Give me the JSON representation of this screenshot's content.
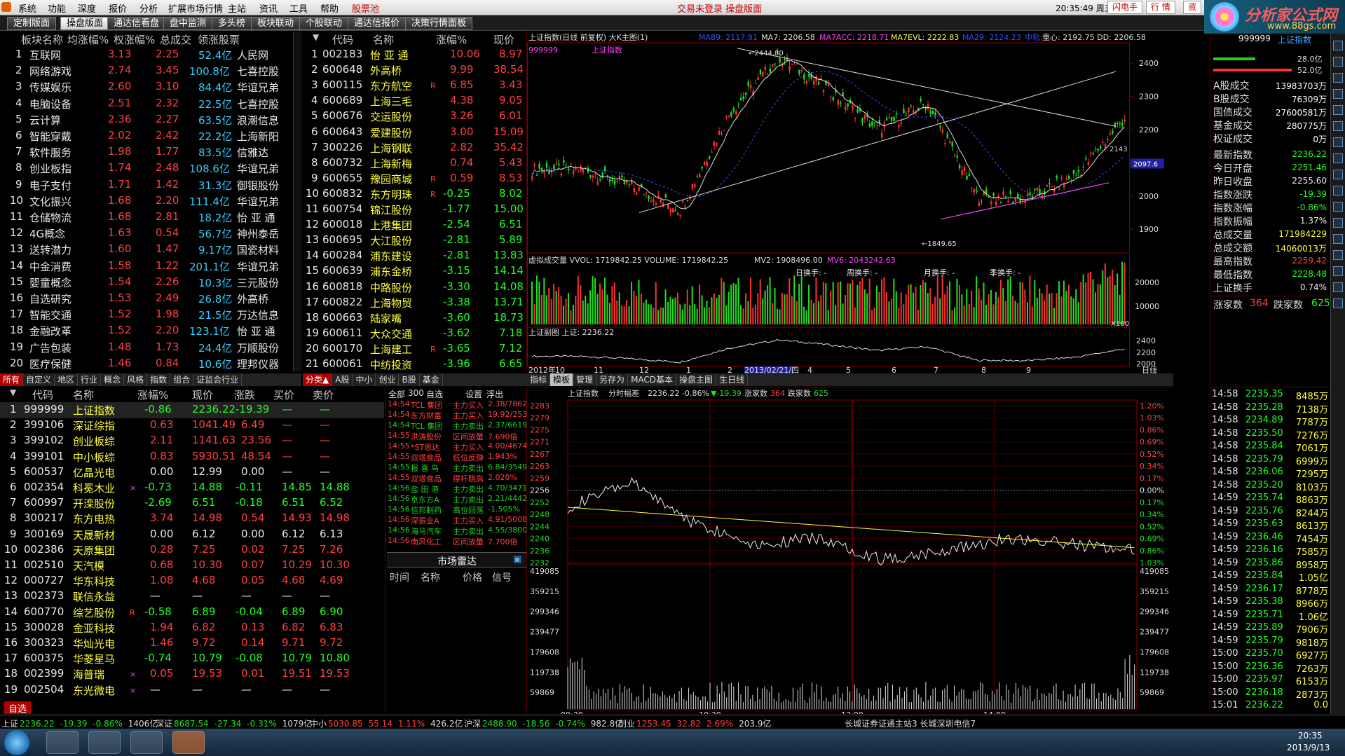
{
  "menu": {
    "items": [
      "系统",
      "功能",
      "深度",
      "报价",
      "分析",
      "扩展市场行情",
      "主站",
      "资讯",
      "工具",
      "帮助",
      "股票池"
    ],
    "center_title": "交易未登录   操盘版面",
    "clock": "20:35:49 周五",
    "right_buttons": [
      "闪电手",
      "行 情",
      "资"
    ]
  },
  "logo": {
    "text": "分析家公式网",
    "url": "www.88gs.com"
  },
  "tabs": [
    "定制版面",
    "操盘版面",
    "通达信看盘",
    "盘中监测",
    "多头榜",
    "板块联动",
    "个股联动",
    "通达信报价",
    "决策行情面板"
  ],
  "sector_table": {
    "headers": [
      "板块名称",
      "均涨幅%",
      "权涨幅%",
      "总成交",
      "领涨股票"
    ],
    "rows": [
      [
        "1",
        "互联网",
        "3.13",
        "2.25",
        "52.4亿",
        "人民网"
      ],
      [
        "2",
        "网络游戏",
        "2.74",
        "3.45",
        "100.8亿",
        "七喜控股"
      ],
      [
        "3",
        "传媒娱乐",
        "2.60",
        "3.10",
        "84.4亿",
        "华谊兄弟"
      ],
      [
        "4",
        "电脑设备",
        "2.51",
        "2.32",
        "22.5亿",
        "七喜控股"
      ],
      [
        "5",
        "云计算",
        "2.36",
        "2.27",
        "63.5亿",
        "浪潮信息"
      ],
      [
        "6",
        "智能穿戴",
        "2.02",
        "2.42",
        "22.2亿",
        "上海新阳"
      ],
      [
        "7",
        "软件服务",
        "1.98",
        "1.77",
        "83.5亿",
        "信雅达"
      ],
      [
        "8",
        "创业板指",
        "1.74",
        "2.48",
        "108.6亿",
        "华谊兄弟"
      ],
      [
        "9",
        "电子支付",
        "1.71",
        "1.42",
        "31.3亿",
        "御银股份"
      ],
      [
        "10",
        "文化振兴",
        "1.68",
        "2.20",
        "111.4亿",
        "华谊兄弟"
      ],
      [
        "11",
        "仓储物流",
        "1.68",
        "2.81",
        "18.2亿",
        "怡 亚 通"
      ],
      [
        "12",
        "4G概念",
        "1.63",
        "0.54",
        "56.7亿",
        "神州泰岳"
      ],
      [
        "13",
        "送转潜力",
        "1.60",
        "1.47",
        "9.17亿",
        "国瓷材料"
      ],
      [
        "14",
        "中金消费",
        "1.58",
        "1.22",
        "201.1亿",
        "华谊兄弟"
      ],
      [
        "15",
        "婴童概念",
        "1.54",
        "2.26",
        "10.3亿",
        "三元股份"
      ],
      [
        "16",
        "自选研究",
        "1.53",
        "2.49",
        "26.8亿",
        "外高桥"
      ],
      [
        "17",
        "智能交通",
        "1.52",
        "1.98",
        "21.5亿",
        "万达信息"
      ],
      [
        "18",
        "金融改革",
        "1.52",
        "2.20",
        "123.1亿",
        "怡 亚 通"
      ],
      [
        "19",
        "广告包装",
        "1.48",
        "1.73",
        "24.4亿",
        "万顺股份"
      ],
      [
        "20",
        "医疗保健",
        "1.46",
        "0.84",
        "10.6亿",
        "理邦仪器"
      ]
    ]
  },
  "stock_rank": {
    "headers": [
      "代码",
      "名称",
      "涨幅%",
      "现价"
    ],
    "rows": [
      [
        "1",
        "002183",
        "怡 亚 通",
        "",
        "10.06",
        "8.97"
      ],
      [
        "2",
        "600648",
        "外高桥",
        "",
        "9.99",
        "38.54"
      ],
      [
        "3",
        "600115",
        "东方航空",
        "R",
        "6.85",
        "3.43"
      ],
      [
        "4",
        "600689",
        "上海三毛",
        "",
        "4.38",
        "9.05"
      ],
      [
        "5",
        "600676",
        "交运股份",
        "",
        "3.26",
        "6.01"
      ],
      [
        "6",
        "600643",
        "爱建股份",
        "",
        "3.00",
        "15.09"
      ],
      [
        "7",
        "300226",
        "上海钢联",
        "",
        "2.82",
        "35.42"
      ],
      [
        "8",
        "600732",
        "上海新梅",
        "",
        "0.74",
        "5.43"
      ],
      [
        "9",
        "600655",
        "豫园商城",
        "R",
        "0.59",
        "8.53"
      ],
      [
        "10",
        "600832",
        "东方明珠",
        "R",
        "-0.25",
        "8.02"
      ],
      [
        "11",
        "600754",
        "锦江股份",
        "",
        "-1.77",
        "15.00"
      ],
      [
        "12",
        "600018",
        "上港集团",
        "",
        "-2.54",
        "6.51"
      ],
      [
        "13",
        "600695",
        "大江股份",
        "",
        "-2.81",
        "5.89"
      ],
      [
        "14",
        "600284",
        "浦东建设",
        "",
        "-2.81",
        "13.83"
      ],
      [
        "15",
        "600639",
        "浦东金桥",
        "",
        "-3.15",
        "14.14"
      ],
      [
        "16",
        "600818",
        "中路股份",
        "",
        "-3.30",
        "14.08"
      ],
      [
        "17",
        "600822",
        "上海物贸",
        "",
        "-3.38",
        "13.71"
      ],
      [
        "18",
        "600663",
        "陆家嘴",
        "",
        "-3.60",
        "18.73"
      ],
      [
        "19",
        "600611",
        "大众交通",
        "",
        "-3.62",
        "7.18"
      ],
      [
        "20",
        "600170",
        "上海建工",
        "R",
        "-3.65",
        "7.12"
      ],
      [
        "21",
        "600061",
        "中纺投资",
        "",
        "-3.96",
        "6.65"
      ]
    ]
  },
  "market_tabs": [
    "所有",
    "自定义",
    "地区",
    "行业",
    "概念",
    "风格",
    "指数",
    "组合",
    "证监会行业"
  ],
  "rank_tabs": [
    "分类▲",
    "A股",
    "中小",
    "创业",
    "B股",
    "基金"
  ],
  "quote_table": {
    "headers": [
      "代码",
      "名称",
      "涨幅%",
      "现价",
      "涨跌",
      "买价",
      "卖价"
    ],
    "rows": [
      [
        "1",
        "999999",
        "上证指数",
        "",
        "-0.86",
        "2236.22",
        "-19.39",
        "—",
        "—"
      ],
      [
        "2",
        "399106",
        "深证综指",
        "",
        "0.63",
        "1041.49",
        "6.49",
        "—",
        "—"
      ],
      [
        "3",
        "399102",
        "创业板综",
        "",
        "2.11",
        "1141.63",
        "23.56",
        "—",
        "—"
      ],
      [
        "4",
        "399101",
        "中小板综",
        "",
        "0.83",
        "5930.51",
        "48.54",
        "—",
        "—"
      ],
      [
        "5",
        "600537",
        "亿晶光电",
        "",
        "0.00",
        "12.99",
        "0.00",
        "—",
        "—"
      ],
      [
        "6",
        "002354",
        "科冕木业",
        "×",
        "-0.73",
        "14.88",
        "-0.11",
        "14.85",
        "14.88"
      ],
      [
        "7",
        "600997",
        "开滦股份",
        "",
        "-2.69",
        "6.51",
        "-0.18",
        "6.51",
        "6.52"
      ],
      [
        "8",
        "300217",
        "东方电热",
        "",
        "3.74",
        "14.98",
        "0.54",
        "14.93",
        "14.98"
      ],
      [
        "9",
        "300169",
        "天晟新材",
        "",
        "0.00",
        "6.12",
        "0.00",
        "6.12",
        "6.13"
      ],
      [
        "10",
        "002386",
        "天原集团",
        "",
        "0.28",
        "7.25",
        "0.02",
        "7.25",
        "7.26"
      ],
      [
        "11",
        "002510",
        "天汽模",
        "",
        "0.68",
        "10.30",
        "0.07",
        "10.29",
        "10.30"
      ],
      [
        "12",
        "000727",
        "华东科技",
        "",
        "1.08",
        "4.68",
        "0.05",
        "4.68",
        "4.69"
      ],
      [
        "13",
        "002373",
        "联信永益",
        "",
        "—",
        "—",
        "—",
        "—",
        "—"
      ],
      [
        "14",
        "600770",
        "综艺股份",
        "R",
        "-0.58",
        "6.89",
        "-0.04",
        "6.89",
        "6.90"
      ],
      [
        "15",
        "300028",
        "金亚科技",
        "",
        "1.94",
        "6.82",
        "0.13",
        "6.82",
        "6.83"
      ],
      [
        "16",
        "300323",
        "华灿光电",
        "",
        "1.46",
        "9.72",
        "0.14",
        "9.71",
        "9.72"
      ],
      [
        "17",
        "600375",
        "华菱星马",
        "",
        "-0.74",
        "10.79",
        "-0.08",
        "10.79",
        "10.80"
      ],
      [
        "18",
        "002399",
        "海普瑞",
        "×",
        "0.05",
        "19.53",
        "0.01",
        "19.51",
        "19.53"
      ],
      [
        "19",
        "002504",
        "东光微电",
        "×",
        "—",
        "—",
        "—",
        "—",
        "—"
      ]
    ],
    "footer_tab": "自选"
  },
  "monitor": {
    "tabs": [
      "全部",
      "300",
      "自选",
      "设置",
      "浮出"
    ],
    "items": [
      [
        "14:54",
        "TCL 集团",
        "主力买入",
        "2.38/7862"
      ],
      [
        "14:54",
        "东方财富",
        "主力买入",
        "19.92/2539"
      ],
      [
        "14:54",
        "TCL 集团",
        "主力卖出",
        "2.37/6619"
      ],
      [
        "14:55",
        "洪涛股份",
        "区间放量",
        "7.690倍"
      ],
      [
        "14:55",
        "*ST思达",
        "主力买入",
        "4.00/4674"
      ],
      [
        "14:55",
        "双塔食品",
        "低位反弹",
        "1.943%"
      ],
      [
        "14:55",
        "报 喜 鸟",
        "主力卖出",
        "6.84/3549"
      ],
      [
        "14:55",
        "双塔食品",
        "撑杆跳高",
        "2.020%"
      ],
      [
        "14:56",
        "盐 田 港",
        "主力卖出",
        "4.70/3471"
      ],
      [
        "14:56",
        "京东方A",
        "主力卖出",
        "2.21/4442"
      ],
      [
        "14:56",
        "信邦制药",
        "高位回落",
        "-1.505%"
      ],
      [
        "14:56",
        "深振业A",
        "主力买入",
        "4.91/5008"
      ],
      [
        "14:56",
        "海马汽车",
        "主力卖出",
        "4.55/3800"
      ],
      [
        "14:56",
        "南风化工",
        "区间放量",
        "7.700倍"
      ]
    ],
    "radar_title": "市场雷达",
    "radar_headers": [
      "时间",
      "名称",
      "价格",
      "信号"
    ]
  },
  "kline": {
    "title": "上证指数(日线 前复权) 大K主图(1)",
    "ma_labels": [
      {
        "text": "MA89: 2117.81",
        "color": "#3050ff"
      },
      {
        "text": "MA7: 2206.58",
        "color": "#e0e0e0"
      },
      {
        "text": "MA7ACC: 2218.71",
        "color": "#ff40ff"
      },
      {
        "text": "MA7EVL: 2222.83",
        "color": "#ffff40"
      },
      {
        "text": "MA29: 2124.23",
        "color": "#3050ff"
      },
      {
        "text": "中轨: ...",
        "color": "#3050ff"
      }
    ],
    "right_info": "重心: 2192.75  DD: 2206.58",
    "subtitle_code": "999999",
    "subtitle_name": "上证指数",
    "yticks": [
      "2400",
      "2300",
      "2200",
      "2100",
      "2000",
      "1900"
    ],
    "high_label": "2444.80",
    "low_label": "1849.65",
    "cur_label": "2097.6",
    "cur_small": "2143"
  },
  "volume": {
    "title": "虚拟成交量  VVOL: 1719842.25  VOLUME: 1719842.25",
    "mv2": "MV2: 1908496.00",
    "mv6": "MV6: 2043242.63",
    "turnover": [
      "日换手: -",
      "周换手: -",
      "月换手: -",
      "季换手: -"
    ],
    "yticks": [
      "20000",
      "10000"
    ],
    "unit": "X100"
  },
  "sub_chart": {
    "title": "上证副图  上证: 2236.22",
    "yticks": [
      "2400",
      "2200",
      "2000"
    ]
  },
  "date_axis": {
    "labels": [
      "2012年",
      "10",
      "11",
      "12",
      "1",
      "2",
      "2013/02/21/四",
      "4",
      "5",
      "6",
      "7",
      "8",
      "9"
    ],
    "unit": "日线"
  },
  "indicator_tabs": [
    "指标",
    "模板",
    "管理",
    "另存为",
    "MACD基本",
    "操盘主图",
    "生日线"
  ],
  "intraday": {
    "title": "上证指数",
    "subtitle": "分时幅差",
    "value": "2236.22 -0.86%",
    "change": "▼-19.39",
    "up_label": "涨家数",
    "up_count": "364",
    "down_label": "跌家数",
    "down_count": "625",
    "left_ticks": [
      "2283",
      "2279",
      "2275",
      "2271",
      "2267",
      "2263",
      "2259",
      "2256",
      "2252",
      "2248",
      "2244",
      "2240",
      "2236",
      "2232"
    ],
    "right_ticks": [
      "1.20%",
      "1.03%",
      "0.86%",
      "0.69%",
      "0.52%",
      "0.34%",
      "0.17%",
      "0.00%",
      "0.17%",
      "0.34%",
      "0.52%",
      "0.69%",
      "0.86%",
      "1.03%"
    ],
    "vol_ticks": [
      "419085",
      "359215",
      "299346",
      "239477",
      "179608",
      "119738",
      "59869"
    ],
    "time_labels": [
      "09:30",
      "10:30",
      "13:00",
      "14:00"
    ]
  },
  "right_info": {
    "code": "999999",
    "name": "上证指数",
    "bars": [
      "28.0亿",
      "52.0亿"
    ],
    "turnover": [
      [
        "A股成交",
        "13983703万"
      ],
      [
        "B股成交",
        "76309万"
      ],
      [
        "国债成交",
        "27600581万"
      ],
      [
        "基金成交",
        "280775万"
      ],
      [
        "权证成交",
        "0万"
      ]
    ],
    "stats": [
      [
        "最新指数",
        "2236.22",
        "green"
      ],
      [
        "今日开盘",
        "2251.46",
        "green"
      ],
      [
        "昨日收盘",
        "2255.60",
        "white"
      ],
      [
        "指数涨跌",
        "-19.39",
        "green"
      ],
      [
        "指数涨幅",
        "-0.86%",
        "green"
      ],
      [
        "指数振幅",
        "1.37%",
        "white"
      ],
      [
        "总成交量",
        "171984229",
        "yellow"
      ],
      [
        "总成交额",
        "14060013万",
        "yellow"
      ],
      [
        "最高指数",
        "2259.42",
        "red"
      ],
      [
        "最低指数",
        "2228.48",
        "green"
      ],
      [
        "上证换手",
        "0.74%",
        "white"
      ]
    ],
    "up_label": "涨家数",
    "up_count": "364",
    "down_label": "跌家数",
    "down_count": "625"
  },
  "ticks": [
    [
      "14:58",
      "2235.35",
      "8485万"
    ],
    [
      "14:58",
      "2235.28",
      "7138万"
    ],
    [
      "14:58",
      "2234.89",
      "7787万"
    ],
    [
      "14:58",
      "2235.50",
      "7276万"
    ],
    [
      "14:58",
      "2235.84",
      "7061万"
    ],
    [
      "14:58",
      "2235.79",
      "6999万"
    ],
    [
      "14:58",
      "2236.06",
      "7295万"
    ],
    [
      "14:58",
      "2235.20",
      "8103万"
    ],
    [
      "14:59",
      "2235.74",
      "8863万"
    ],
    [
      "14:59",
      "2235.76",
      "8244万"
    ],
    [
      "14:59",
      "2235.63",
      "8613万"
    ],
    [
      "14:59",
      "2236.46",
      "7454万"
    ],
    [
      "14:59",
      "2236.16",
      "7585万"
    ],
    [
      "14:59",
      "2235.86",
      "8958万"
    ],
    [
      "14:59",
      "2235.84",
      "1.05亿"
    ],
    [
      "14:59",
      "2236.17",
      "8778万"
    ],
    [
      "14:59",
      "2235.38",
      "8966万"
    ],
    [
      "14:59",
      "2235.71",
      "1.06亿"
    ],
    [
      "14:59",
      "2235.89",
      "7906万"
    ],
    [
      "14:59",
      "2235.79",
      "9818万"
    ],
    [
      "15:00",
      "2235.70",
      "6927万"
    ],
    [
      "15:00",
      "2236.36",
      "7263万"
    ],
    [
      "15:00",
      "2235.97",
      "6153万"
    ],
    [
      "15:00",
      "2236.18",
      "2873万"
    ],
    [
      "15:01",
      "2236.22",
      "0.0"
    ]
  ],
  "status_bar": {
    "items": [
      {
        "label": "上证",
        "value": "2236.22",
        "chg": "-19.39",
        "pct": "-0.86%",
        "vol": "1406亿"
      },
      {
        "label": "深证",
        "value": "8687.54",
        "chg": "-27.34",
        "pct": "-0.31%",
        "vol": "1079亿"
      },
      {
        "label": "中小",
        "value": "5030.85",
        "chg": "55.14",
        "pct": "1.11%",
        "vol": "426.2亿"
      },
      {
        "label": "沪深",
        "value": "2488.90",
        "chg": "-18.56",
        "pct": "-0.74%",
        "vol": "982.8亿"
      },
      {
        "label": "创业",
        "value": "1253.45",
        "chg": "32.82",
        "pct": "2.69%",
        "vol": "203.9亿"
      }
    ],
    "server": "长城证券证通主站3  长城深圳电信7"
  },
  "taskbar": {
    "time": "20:35",
    "date": "2013/9/13"
  },
  "chart_data": [
    {
      "type": "line",
      "title": "上证指数(日线 前复权)",
      "x": [
        "2012-09",
        "2012-10",
        "2012-11",
        "2012-12",
        "2013-01",
        "2013-02",
        "2013-03",
        "2013-04",
        "2013-05",
        "2013-06",
        "2013-07",
        "2013-08",
        "2013-09"
      ],
      "series": [
        {
          "name": "上证",
          "values": [
            2080,
            2080,
            2030,
            1960,
            2250,
            2420,
            2320,
            2200,
            2280,
            2000,
            1990,
            2060,
            2236
          ]
        }
      ],
      "ylim": [
        1849.65,
        2444.8
      ]
    },
    {
      "type": "line",
      "title": "上证指数 分时",
      "x": [
        "09:30",
        "10:00",
        "10:30",
        "11:00",
        "11:30",
        "13:00",
        "13:30",
        "14:00",
        "14:30",
        "15:00"
      ],
      "series": [
        {
          "name": "上证指数",
          "values": [
            2250,
            2258,
            2245,
            2238,
            2240,
            2233,
            2236,
            2240,
            2238,
            2236.22
          ]
        }
      ],
      "ylim": [
        2232,
        2283
      ]
    }
  ]
}
